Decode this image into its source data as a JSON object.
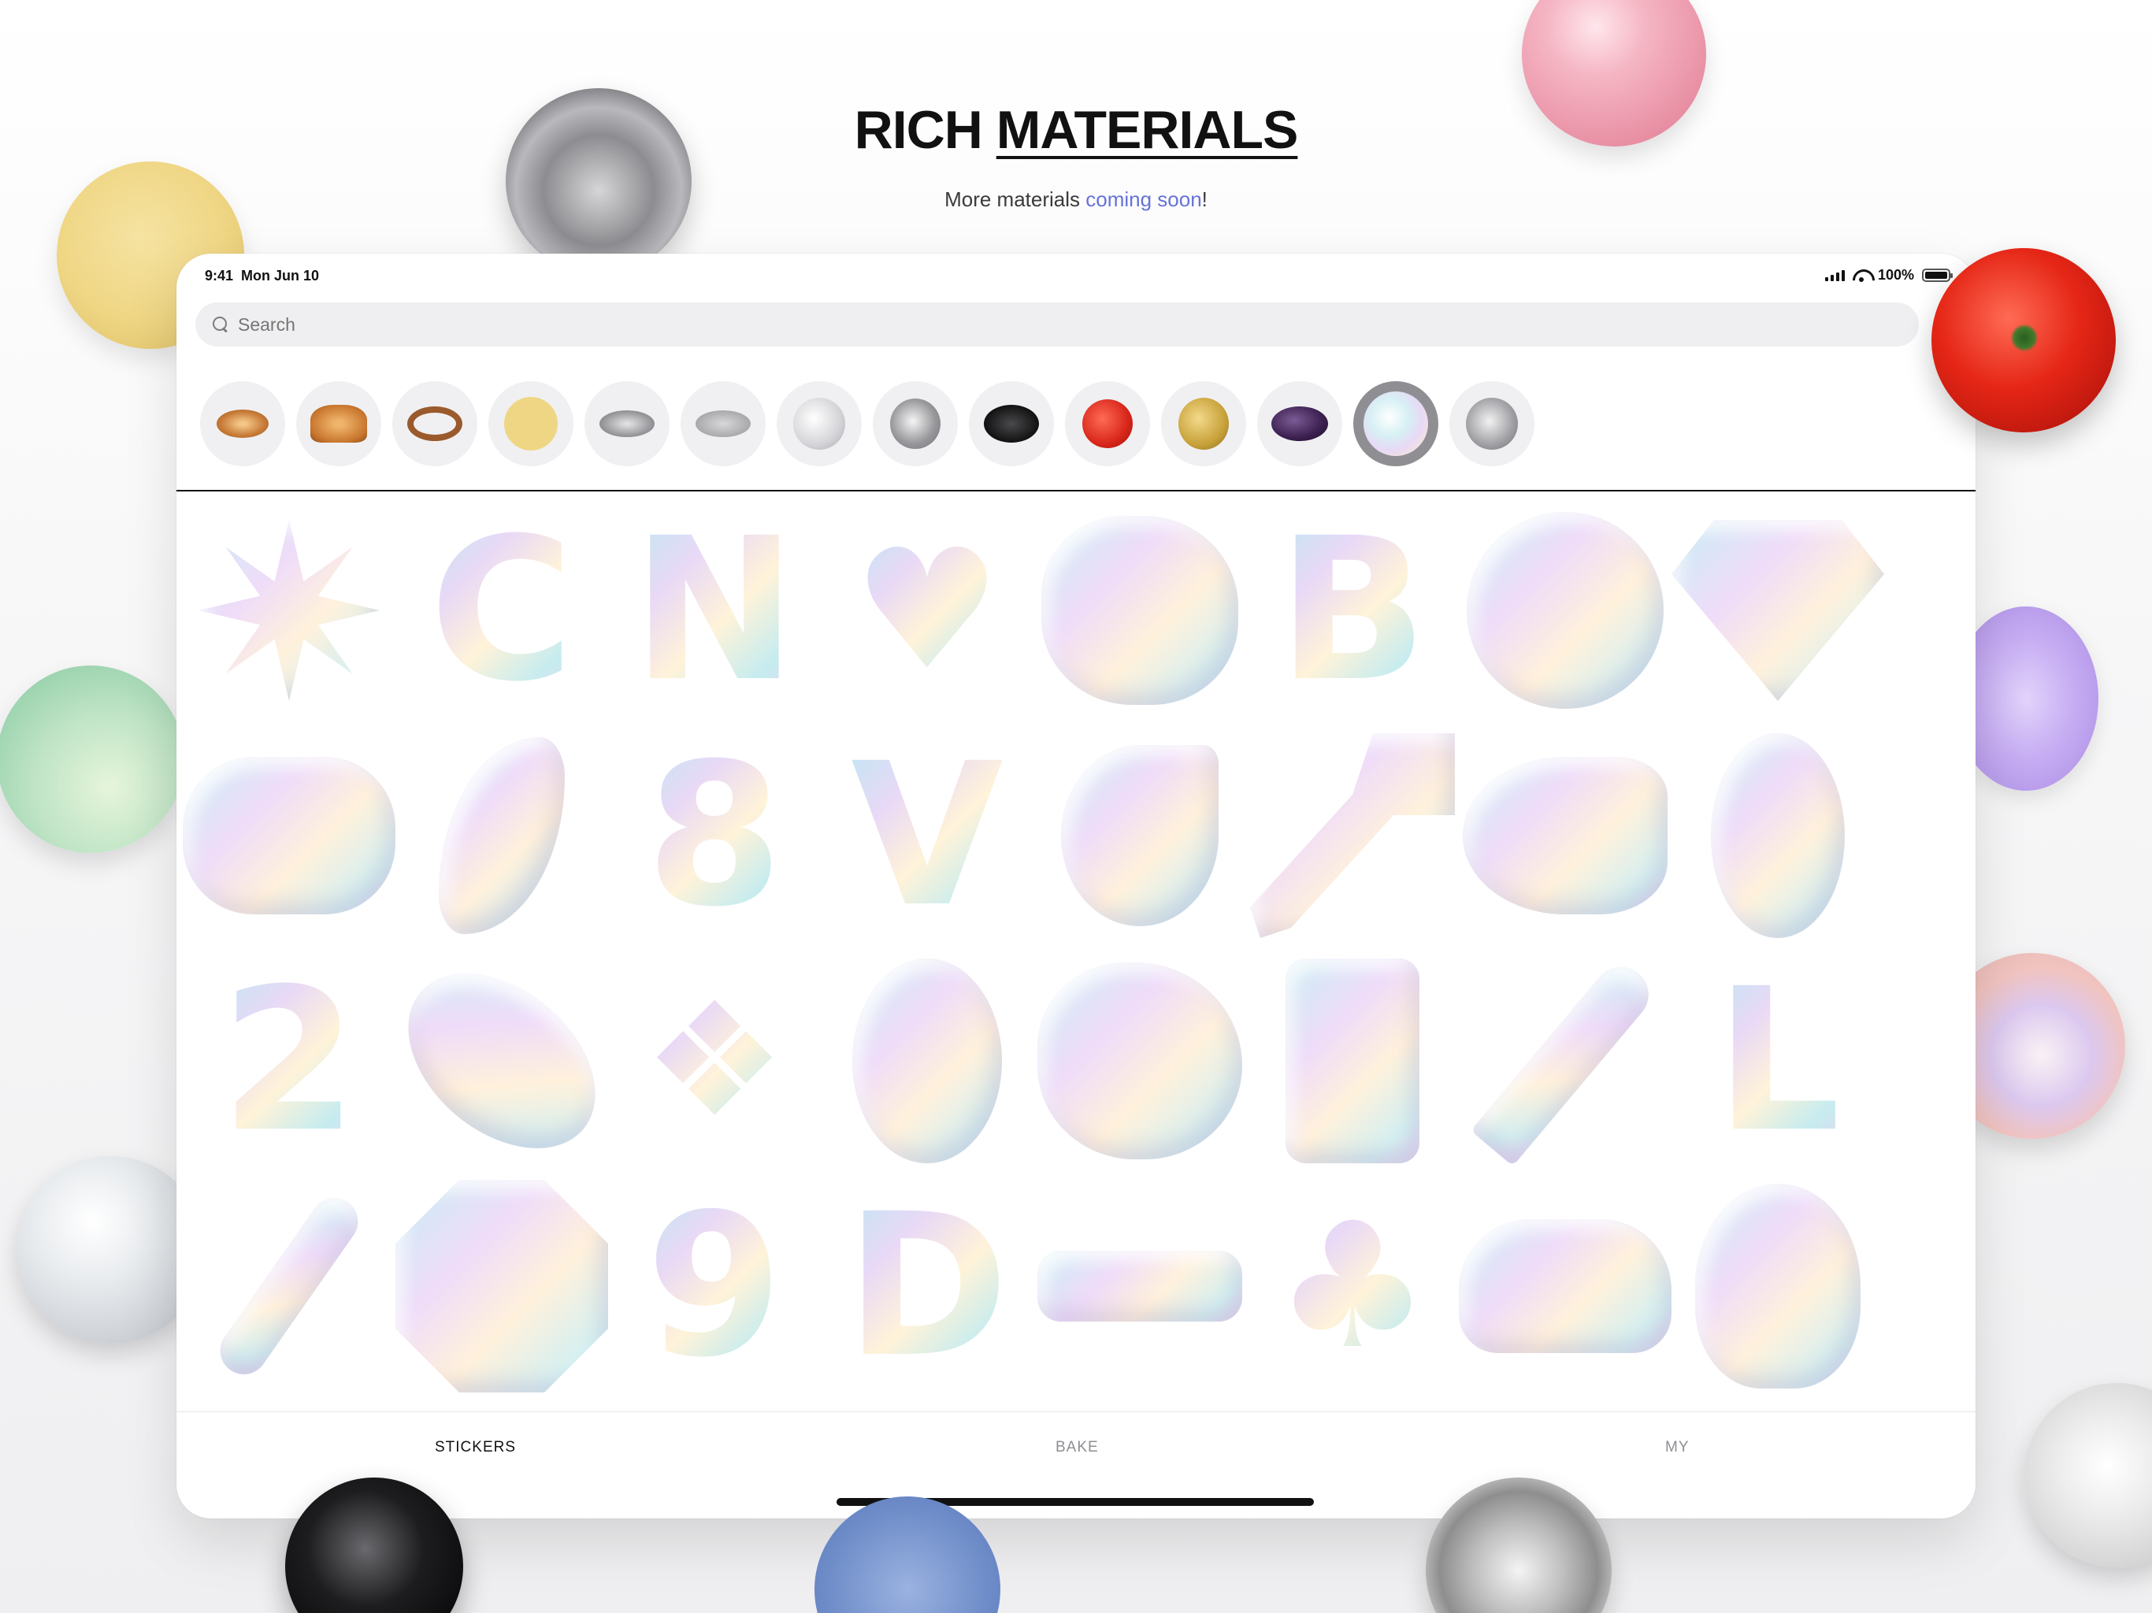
{
  "header": {
    "title_part1": "RICH ",
    "title_part2": "MATERIALS",
    "subtitle_prefix": "More materials ",
    "subtitle_link": "coming soon",
    "subtitle_suffix": "!"
  },
  "status": {
    "time": "9:41",
    "date": "Mon Jun 10",
    "battery": "100%"
  },
  "search": {
    "placeholder": "Search"
  },
  "materials": [
    {
      "name": "bagel",
      "color": "#d08a45"
    },
    {
      "name": "croissant",
      "color": "#c9762e"
    },
    {
      "name": "ring",
      "color": "#9a5a2c"
    },
    {
      "name": "butter",
      "color": "#efd684"
    },
    {
      "name": "metal-disc",
      "color": "#9a9a9e"
    },
    {
      "name": "pewter-disc",
      "color": "#a9a9ad"
    },
    {
      "name": "pearl",
      "color": "#d9d9dc"
    },
    {
      "name": "chrome",
      "color": "#a8a8ac"
    },
    {
      "name": "black",
      "color": "#1a1a1c"
    },
    {
      "name": "tomato",
      "color": "#d8261a"
    },
    {
      "name": "gold",
      "color": "#c8a23a"
    },
    {
      "name": "eggplant",
      "color": "#3b1f4f"
    },
    {
      "name": "iridescent",
      "color": "#e8e2f5",
      "selected": true
    },
    {
      "name": "silver",
      "color": "#bdbdc1"
    }
  ],
  "tabs": {
    "stickers": "STICKERS",
    "bake": "BAKE",
    "my": "MY"
  }
}
